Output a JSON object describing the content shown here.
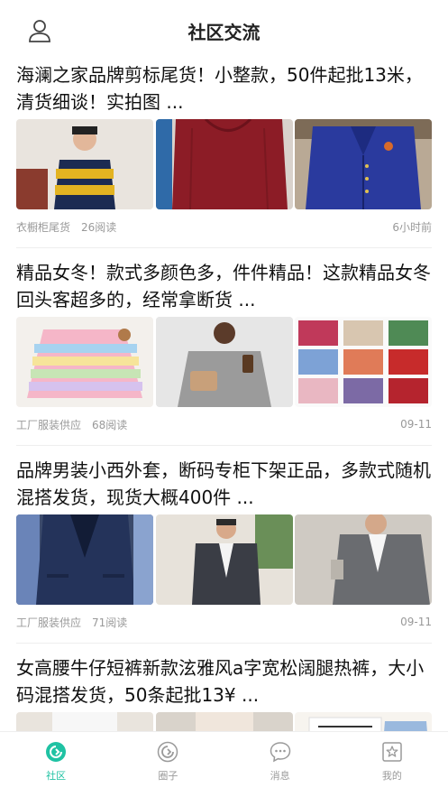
{
  "header": {
    "title": "社区交流",
    "user_icon": "user-icon"
  },
  "posts": [
    {
      "title": "海澜之家品牌剪标尾货！小整款，50件起批13米，清货细谈！实拍图 ...",
      "images": [
        "sweater-navy-yellow-stripes",
        "sweater-maroon",
        "cardigan-royal-blue"
      ],
      "source": "衣橱柜尾货",
      "reads": "26阅读",
      "time": "6小时前"
    },
    {
      "title": "精品女冬！款式多颜色多，件件精品！这款精品女冬回头客超多的，经常拿断货 ...",
      "images": [
        "rainbow-knit-sweater",
        "grey-knit-sweater",
        "sweater-grid"
      ],
      "source": "工厂服装供应",
      "reads": "68阅读",
      "time": "09-11"
    },
    {
      "title": "品牌男装小西外套，断码专柜下架正品，多款式随机混搭发货，现货大概400件 ...",
      "images": [
        "navy-blazer-rack",
        "grey-blazer-model",
        "grey-blazer-closeup"
      ],
      "source": "工厂服装供应",
      "reads": "71阅读",
      "time": "09-11"
    },
    {
      "title": "女高腰牛仔短裤新款泫雅风a字宽松阔腿热裤，大小码混搭发货，50条起批13¥ ...",
      "images": [
        "denim-shorts-1",
        "denim-shorts-2",
        "denim-shorts-3"
      ],
      "source": "",
      "reads": "",
      "time": ""
    }
  ],
  "tabbar": {
    "items": [
      {
        "label": "社区",
        "icon": "community-icon",
        "active": true
      },
      {
        "label": "圈子",
        "icon": "circle-icon",
        "active": false
      },
      {
        "label": "消息",
        "icon": "message-icon",
        "active": false
      },
      {
        "label": "我的",
        "icon": "profile-star-icon",
        "active": false
      }
    ]
  },
  "colors": {
    "accent": "#1fc2a3",
    "inactive": "#9a9a9a",
    "meta": "#999999"
  }
}
